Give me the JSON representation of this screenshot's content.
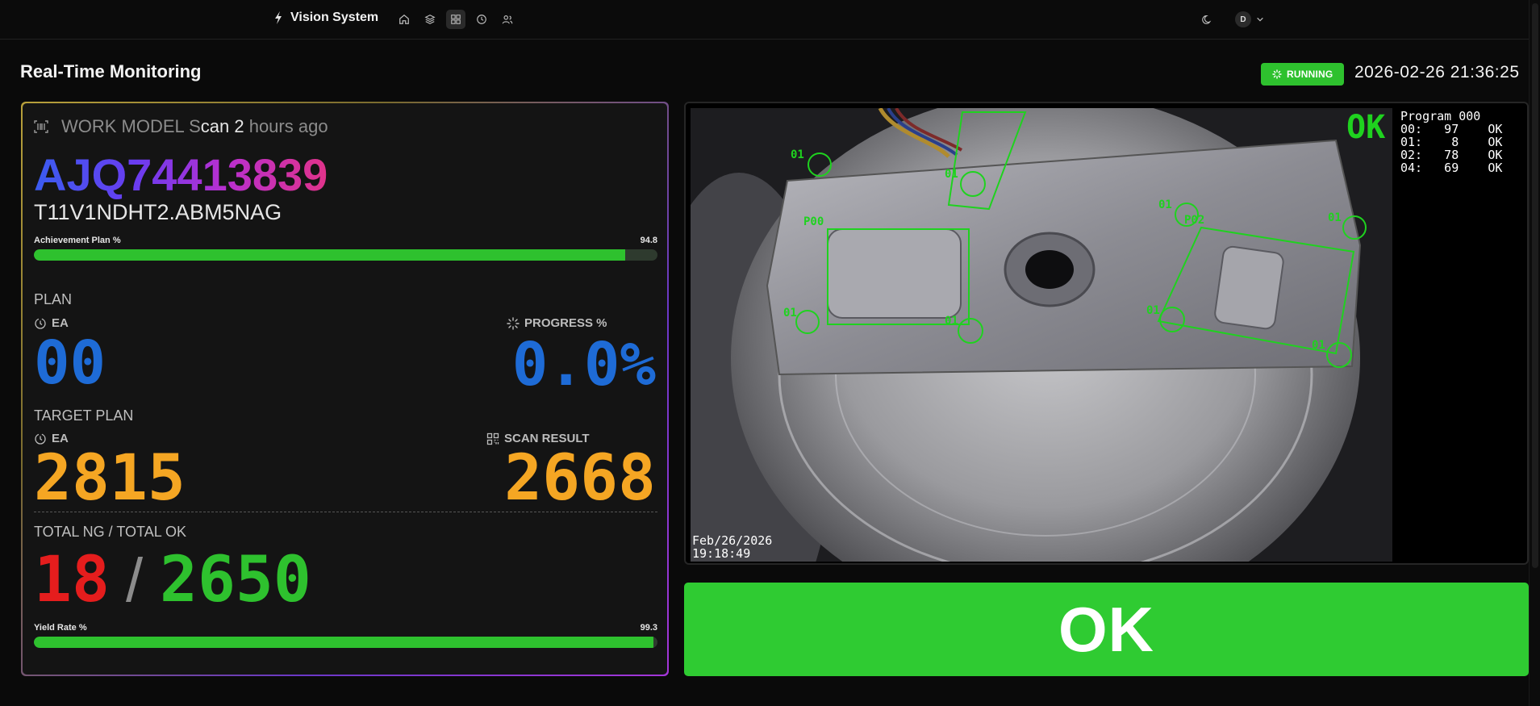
{
  "navbar": {
    "brand": "Vision System",
    "nav_items": [
      {
        "name": "home-icon"
      },
      {
        "name": "layers-icon"
      },
      {
        "name": "grid-icon",
        "active": true
      },
      {
        "name": "history-icon"
      },
      {
        "name": "users-icon"
      }
    ],
    "theme_icon": "moon-icon",
    "avatar_initial": "D"
  },
  "header": {
    "title": "Real-Time Monitoring",
    "status": "RUNNING",
    "datetime": "2026-02-26 21:36:25"
  },
  "work_model": {
    "label_prefix": "WORK MODEL S",
    "label_scan": "can 2",
    "label_suffix": " hours ago",
    "code": "AJQ74413839",
    "sub_code": "T11V1NDHT2.ABM5NAG"
  },
  "achievement": {
    "label": "Achievement Plan %",
    "value_text": "94.8",
    "percent": 94.8
  },
  "plan": {
    "section_label": "PLAN",
    "ea_label": "EA",
    "ea_value": "00",
    "progress_label": "PROGRESS %",
    "progress_value": "0.0%"
  },
  "target": {
    "section_label": "TARGET PLAN",
    "ea_label": "EA",
    "ea_value": "2815",
    "scan_label": "SCAN RESULT",
    "scan_value": "2668"
  },
  "totals": {
    "section_label": "TOTAL NG / TOTAL OK",
    "ng": "18",
    "separator": "/",
    "ok": "2650"
  },
  "yield": {
    "label": "Yield Rate %",
    "value_text": "99.3",
    "percent": 99.3
  },
  "camera": {
    "result": "OK",
    "program_lines": [
      "Program 000",
      "00:   97    OK",
      "01:    8    OK",
      "02:   78    OK",
      "04:   69    OK"
    ],
    "timestamp_date": "Feb/26/2026",
    "timestamp_time": "19:18:49",
    "detections": [
      {
        "label": "01"
      },
      {
        "label": "01"
      },
      {
        "label": "01"
      },
      {
        "label": "01"
      },
      {
        "label": "P00"
      },
      {
        "label": "P02"
      },
      {
        "label": "01"
      },
      {
        "label": "01"
      },
      {
        "label": "01"
      },
      {
        "label": "01"
      }
    ]
  },
  "result_banner": "OK",
  "colors": {
    "ok_green": "#2fcb32",
    "plan_blue": "#1e6bd6",
    "target_orange": "#f5a623",
    "ng_red": "#e51d1d",
    "ok_text_green": "#2ec12e"
  }
}
